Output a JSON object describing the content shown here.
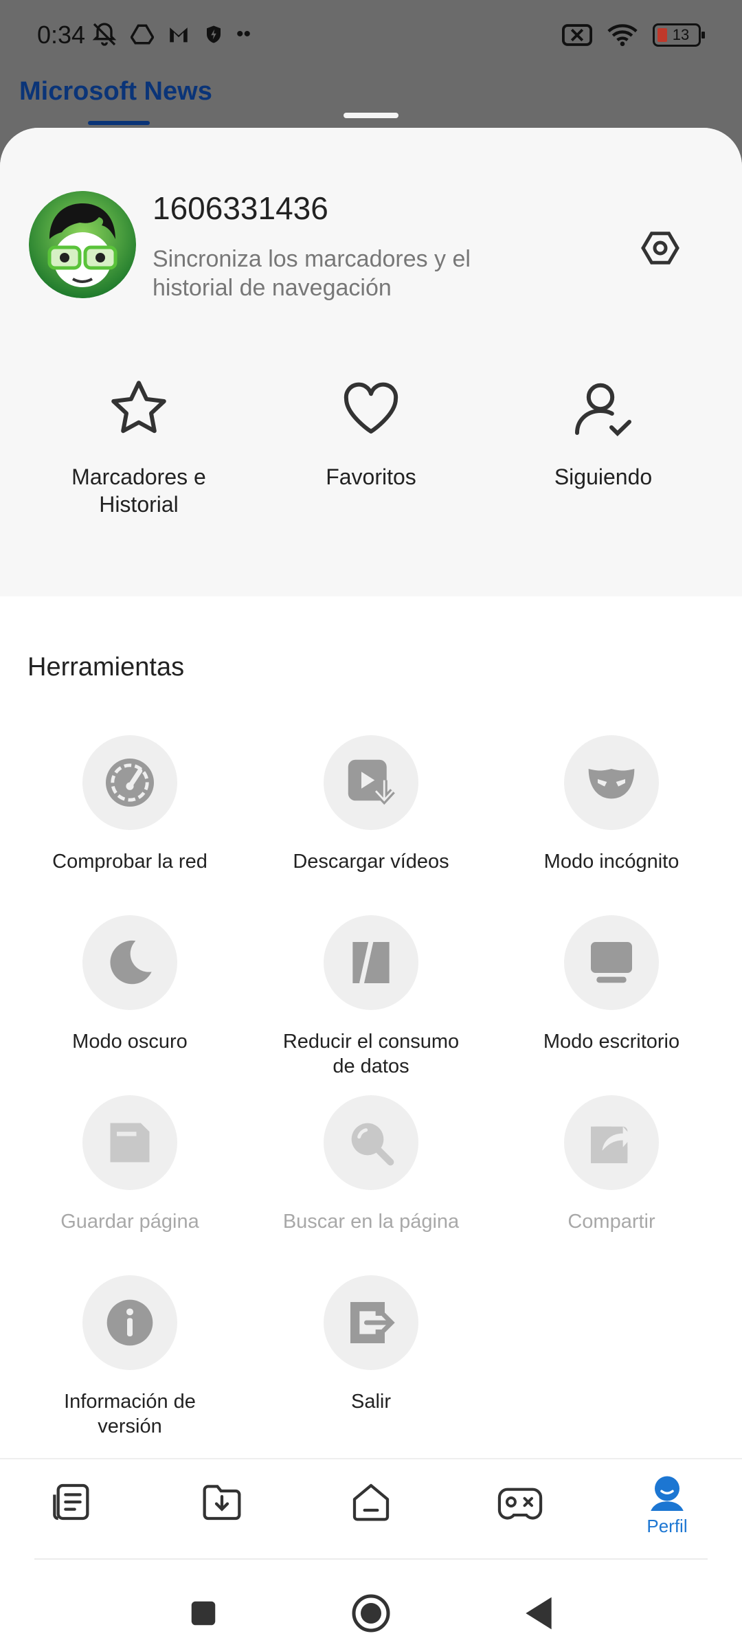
{
  "status_bar": {
    "time": "0:34",
    "battery_level": "13"
  },
  "background_app": {
    "title": "Microsoft News"
  },
  "profile": {
    "user_id": "1606331436",
    "sync_text": "Sincroniza los marcadores y el historial de navegación"
  },
  "quick_actions": [
    {
      "label": "Marcadores e\nHistorial",
      "icon": "star-icon"
    },
    {
      "label": "Favoritos",
      "icon": "heart-icon"
    },
    {
      "label": "Siguiendo",
      "icon": "user-check-icon"
    }
  ],
  "tools": {
    "title": "Herramientas",
    "items": [
      {
        "label": "Comprobar la red",
        "icon": "speedometer-icon",
        "enabled": true
      },
      {
        "label": "Descargar vídeos",
        "icon": "video-download-icon",
        "enabled": true
      },
      {
        "label": "Modo incógnito",
        "icon": "mask-icon",
        "enabled": true
      },
      {
        "label": "Modo oscuro",
        "icon": "moon-icon",
        "enabled": true
      },
      {
        "label": "Reducir el consumo\nde datos",
        "icon": "data-saver-icon",
        "enabled": true
      },
      {
        "label": "Modo escritorio",
        "icon": "desktop-icon",
        "enabled": true
      },
      {
        "label": "Guardar página",
        "icon": "save-icon",
        "enabled": false
      },
      {
        "label": "Buscar en la página",
        "icon": "search-icon",
        "enabled": false
      },
      {
        "label": "Compartir",
        "icon": "share-icon",
        "enabled": false
      },
      {
        "label": "Información de\nversión",
        "icon": "info-icon",
        "enabled": true
      },
      {
        "label": "Salir",
        "icon": "exit-icon",
        "enabled": true
      }
    ]
  },
  "bottom_nav": {
    "items": [
      {
        "icon": "news-icon"
      },
      {
        "icon": "downloads-folder-icon"
      },
      {
        "icon": "home-icon"
      },
      {
        "icon": "games-icon"
      },
      {
        "icon": "profile-icon",
        "label": "Perfil",
        "active": true
      }
    ]
  },
  "colors": {
    "accent": "#1c76d2",
    "title_blue": "#0a3478",
    "icon_gray": "#9a9a9a"
  }
}
